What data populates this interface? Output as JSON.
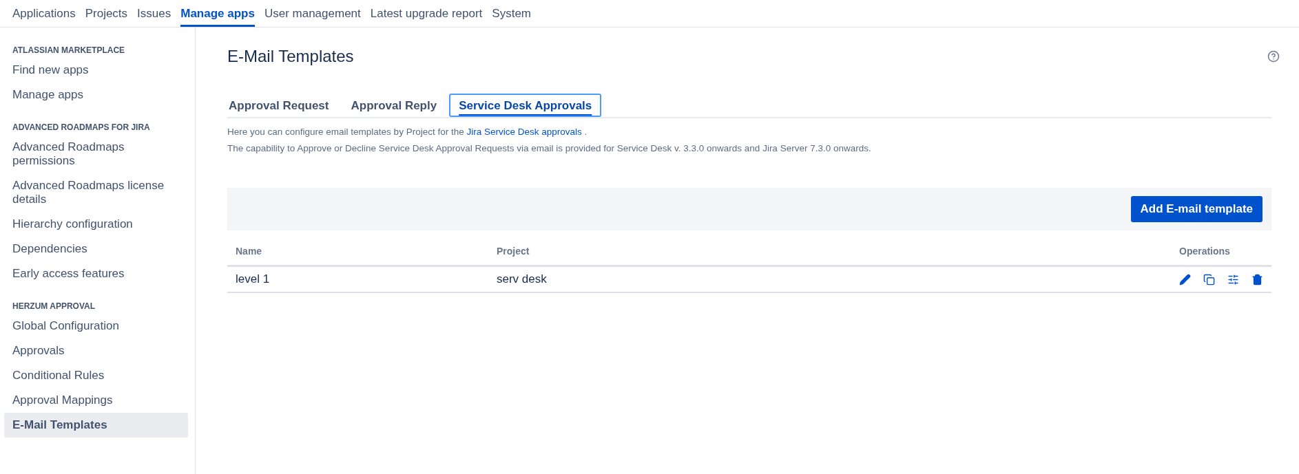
{
  "top_nav": [
    {
      "label": "Applications",
      "selected": false
    },
    {
      "label": "Projects",
      "selected": false
    },
    {
      "label": "Issues",
      "selected": false
    },
    {
      "label": "Manage apps",
      "selected": true
    },
    {
      "label": "User management",
      "selected": false
    },
    {
      "label": "Latest upgrade report",
      "selected": false
    },
    {
      "label": "System",
      "selected": false
    }
  ],
  "sidebar": {
    "sections": [
      {
        "heading": "ATLASSIAN MARKETPLACE",
        "items": [
          {
            "label": "Find new apps",
            "selected": false
          },
          {
            "label": "Manage apps",
            "selected": false
          }
        ]
      },
      {
        "heading": "ADVANCED ROADMAPS FOR JIRA",
        "items": [
          {
            "label": "Advanced Roadmaps permissions",
            "selected": false
          },
          {
            "label": "Advanced Roadmaps license details",
            "selected": false
          },
          {
            "label": "Hierarchy configuration",
            "selected": false
          },
          {
            "label": "Dependencies",
            "selected": false
          },
          {
            "label": "Early access features",
            "selected": false
          }
        ]
      },
      {
        "heading": "HERZUM APPROVAL",
        "items": [
          {
            "label": "Global Configuration",
            "selected": false
          },
          {
            "label": "Approvals",
            "selected": false
          },
          {
            "label": "Conditional Rules",
            "selected": false
          },
          {
            "label": "Approval Mappings",
            "selected": false
          },
          {
            "label": "E-Mail Templates",
            "selected": true
          }
        ]
      }
    ]
  },
  "page": {
    "title": "E-Mail Templates",
    "tabs": [
      {
        "label": "Approval Request",
        "selected": false
      },
      {
        "label": "Approval Reply",
        "selected": false
      },
      {
        "label": "Service Desk Approvals",
        "selected": true
      }
    ],
    "description": {
      "before": "Here you can configure email templates by Project for the",
      "link": "Jira Service Desk approvals",
      "after": "."
    },
    "note": "The capability to Approve or Decline Service Desk Approval Requests via email is provided for Service Desk v. 3.3.0 onwards and Jira Server 7.3.0 onwards.",
    "add_button": "Add E-mail template",
    "table": {
      "columns": [
        "Name",
        "Project",
        "Operations"
      ],
      "rows": [
        {
          "name": "level 1",
          "project": "serv desk"
        }
      ]
    }
  }
}
